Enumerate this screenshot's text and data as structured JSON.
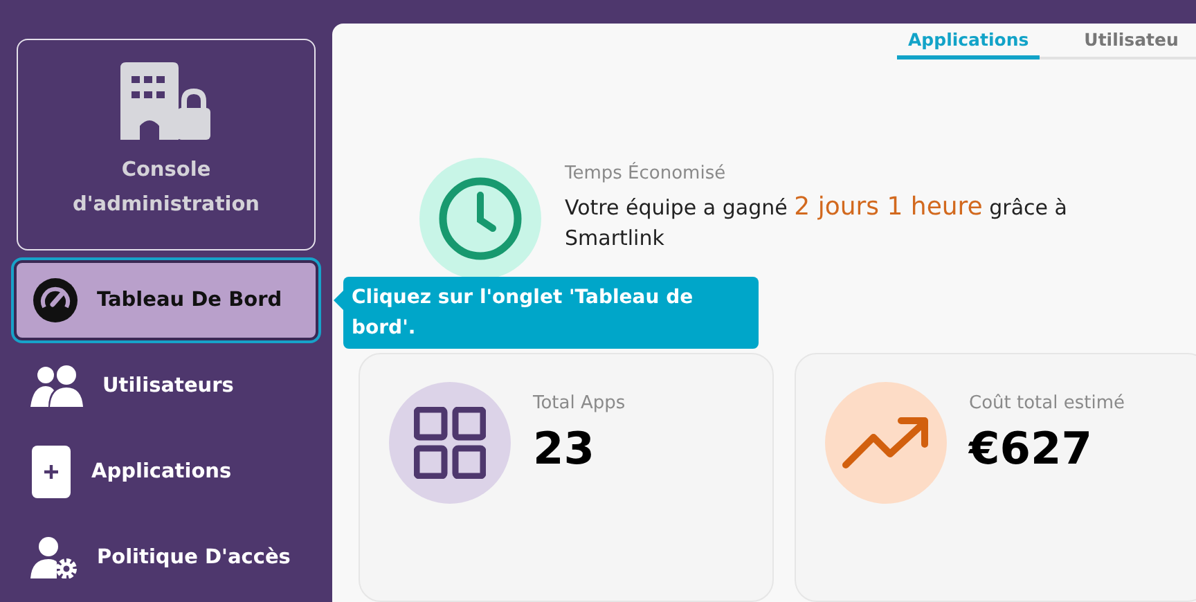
{
  "sidebar": {
    "console": {
      "label": "Console d'administration"
    },
    "items": [
      {
        "kind": "dashboard",
        "label": "Tableau De Bord",
        "selected": true
      },
      {
        "kind": "users",
        "label": "Utilisateurs",
        "selected": false
      },
      {
        "kind": "apps",
        "label": "Applications",
        "selected": false
      },
      {
        "kind": "policy",
        "label": "Politique D'accès",
        "selected": false
      }
    ]
  },
  "tabs": [
    {
      "label": "Applications",
      "selected": true
    },
    {
      "label": "Utilisateu",
      "selected": false
    }
  ],
  "time_saved": {
    "label": "Temps Économisé",
    "sentence_start": "Votre équipe a gagné ",
    "highlight": "2 jours 1 heure",
    "sentence_end": " grâce à Smartlink"
  },
  "tooltip": {
    "text": "Cliquez sur l'onglet 'Tableau de bord'."
  },
  "stats": [
    {
      "kind": "apps",
      "label": "Total Apps",
      "value": "23"
    },
    {
      "kind": "cost",
      "label": "Coût total estimé",
      "value": "€627"
    }
  ]
}
